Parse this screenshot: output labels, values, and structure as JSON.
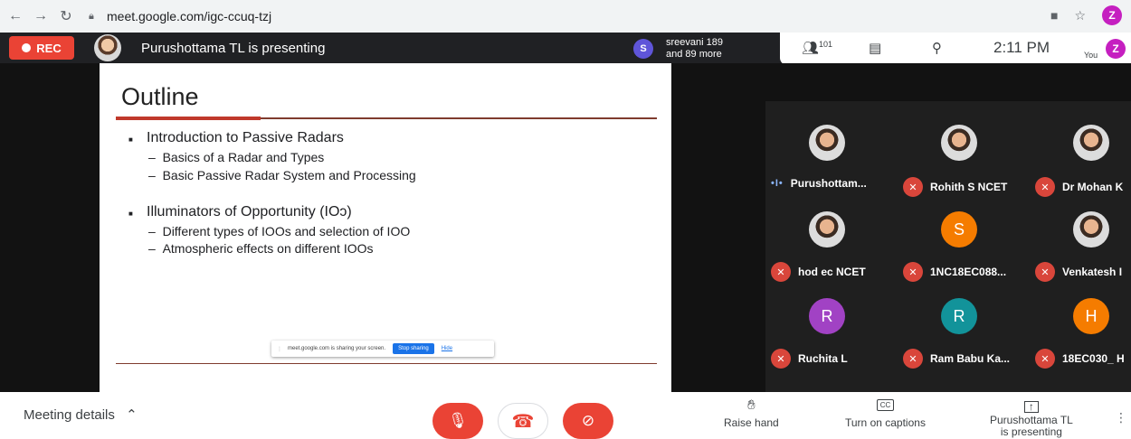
{
  "browser": {
    "url": "meet.google.com/igc-ccuq-tzj",
    "profile_initial": "Z"
  },
  "topbar": {
    "rec_label": "REC",
    "presenting_title": "Purushottama TL is presenting",
    "others_avatar": "S",
    "others_line1": "sreevani 189",
    "others_line2": "and 89 more",
    "participant_count": "101",
    "time": "2:11 PM",
    "you_label": "You",
    "you_initial": "Z"
  },
  "slide": {
    "title": "Outline",
    "bullets": [
      {
        "text": "Introduction to Passive Radars",
        "subs": [
          "Basics of a Radar and Types",
          "Basic Passive Radar System and Processing"
        ]
      },
      {
        "text": "Illuminators of Opportunity (IOↄ)",
        "subs": [
          "Different types of IOOs and selection of IOO",
          "Atmospheric effects on different IOOs"
        ]
      }
    ],
    "share_banner": {
      "text": "meet.google.com is sharing your screen.",
      "stop_label": "Stop sharing",
      "hide_label": "Hide"
    }
  },
  "participants": [
    {
      "name": "Purushottam...",
      "avatar": "",
      "photo": true,
      "muted": false,
      "color": ""
    },
    {
      "name": "Rohith S NCET",
      "avatar": "",
      "photo": true,
      "muted": true,
      "color": ""
    },
    {
      "name": "Dr Mohan K",
      "avatar": "",
      "photo": true,
      "muted": true,
      "color": ""
    },
    {
      "name": "hod ec NCET",
      "avatar": "",
      "photo": true,
      "muted": true,
      "color": ""
    },
    {
      "name": "1NC18EC088...",
      "avatar": "S",
      "photo": false,
      "muted": true,
      "color": "#f57c00"
    },
    {
      "name": "Venkatesh I",
      "avatar": "",
      "photo": true,
      "muted": true,
      "color": ""
    },
    {
      "name": "Ruchita L",
      "avatar": "R",
      "photo": false,
      "muted": true,
      "color": "#a142c4"
    },
    {
      "name": "Ram Babu Ka...",
      "avatar": "R",
      "photo": false,
      "muted": true,
      "color": "#12939a"
    },
    {
      "name": "18EC030_ H",
      "avatar": "H",
      "photo": false,
      "muted": true,
      "color": "#f57c00"
    }
  ],
  "bottombar": {
    "meeting_details": "Meeting details",
    "raise_hand": "Raise hand",
    "captions": "Turn on captions",
    "cc_icon": "CC",
    "presenting_line1": "Purushottama TL",
    "presenting_line2": "is presenting"
  }
}
